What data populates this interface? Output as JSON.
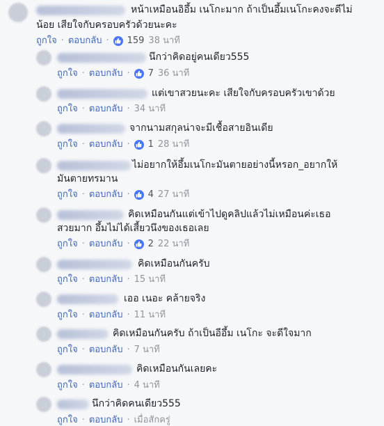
{
  "labels": {
    "like": "ถูกใจ",
    "reply": "ตอบกลับ",
    "sep": "·"
  },
  "colors": {
    "link": "#4267b2",
    "like_icon": "#4a76f5",
    "meta": "#90949c",
    "text": "#1d2129"
  },
  "comments": [
    {
      "lines": [
        "หน้าเหมือนอิอึ้ม เนโกะมาก ถ้าเป็นอึ้มเนโกะคงจะดีไม่",
        "น้อย เสียใจกับครอบครัวด้วยนะคะ"
      ],
      "likes": "159",
      "time": "38 นาที"
    },
    {
      "lines": [
        "นึกว่าคิดอยู่คนเดียว555"
      ],
      "likes": "7",
      "time": "36 นาที"
    },
    {
      "lines": [
        "แต่เขาสวยนะคะ เสียใจกับครอบครัวเขาด้วย"
      ],
      "likes": "",
      "time": "34 นาที"
    },
    {
      "lines": [
        "จากนามสกุลน่าจะมีเชื้อสายอินเดีย"
      ],
      "likes": "1",
      "time": "28 นาที"
    },
    {
      "lines": [
        "ไม่อยากให้อึ้มเนโกะมันตายอย่างนี้หรอก_อยากให้",
        "มันตายทรมาน"
      ],
      "likes": "4",
      "time": "27 นาที"
    },
    {
      "lines": [
        "คิดเหมือนกันแต่เข้าไปดูคลิปแล้วไม่เหมือนค่ะเธอ",
        "สวยมาก อึ้มไม่ได้เสี้ยวนึงของเธอเลย"
      ],
      "likes": "2",
      "time": "22 นาที"
    },
    {
      "lines": [
        "คิดเหมือนกันครับ"
      ],
      "likes": "",
      "time": "15 นาที"
    },
    {
      "lines": [
        "เออ เนอะ คล้ายจริง"
      ],
      "likes": "",
      "time": "11 นาที"
    },
    {
      "lines": [
        "คิดเหมือนกันครับ ถ้าเป็นอีอึ้ม เนโกะ จะดีใจมาก"
      ],
      "likes": "",
      "time": "7 นาที"
    },
    {
      "lines": [
        "คิดเหมือนกันเลยคะ"
      ],
      "likes": "",
      "time": "4 นาที"
    },
    {
      "lines": [
        "นึกว่าคิดคนเดียว555"
      ],
      "likes": "",
      "time": "เมื่อสักครู่"
    }
  ]
}
